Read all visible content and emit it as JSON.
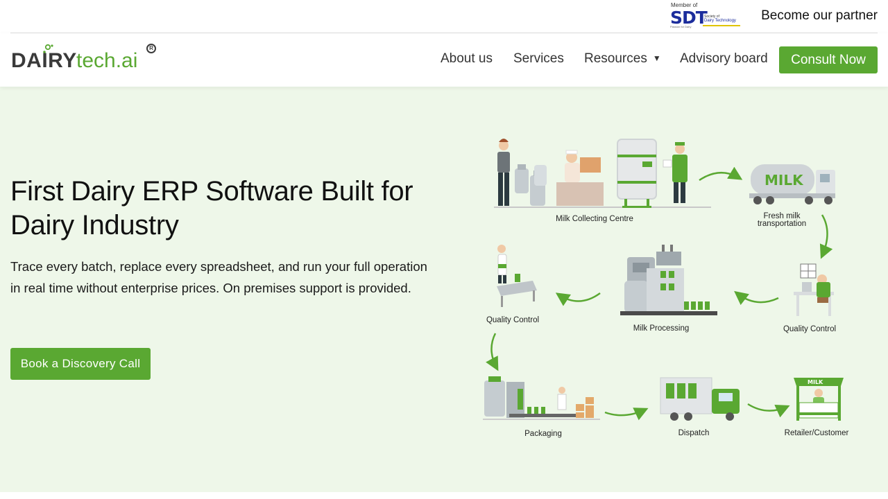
{
  "topbar": {
    "sdt_member": "Member of",
    "sdt_abbr": "SDT",
    "sdt_line1": "Society of",
    "sdt_line2": "Dairy Technology",
    "sdt_tagline": "Passion for Dairy",
    "partner_link": "Become our partner"
  },
  "logo": {
    "word1": "DAIRY",
    "word2": "tech.ai",
    "reg": "R"
  },
  "nav": {
    "about": "About us",
    "services": "Services",
    "resources": "Resources",
    "advisory": "Advisory board",
    "consult": "Consult Now"
  },
  "hero": {
    "title": "First Dairy ERP Software Built for Dairy Industry",
    "description": "Trace every batch, replace every spreadsheet, and run your full operation in real time without enterprise prices. On premises support is provided.",
    "cta": "Book a Discovery Call"
  },
  "flow": {
    "steps": [
      "Milk Collecting Centre",
      "Fresh milk",
      "transportation",
      "Quality Control",
      "Milk Processing",
      "Quality Control",
      "Packaging",
      "Dispatch",
      "Retailer/Customer"
    ],
    "truck_text": "MILK",
    "shop_text": "MILK"
  },
  "colors": {
    "brand_green": "#5aa832",
    "hero_bg": "#eef7e9",
    "sdt_blue": "#1c2d9c"
  }
}
